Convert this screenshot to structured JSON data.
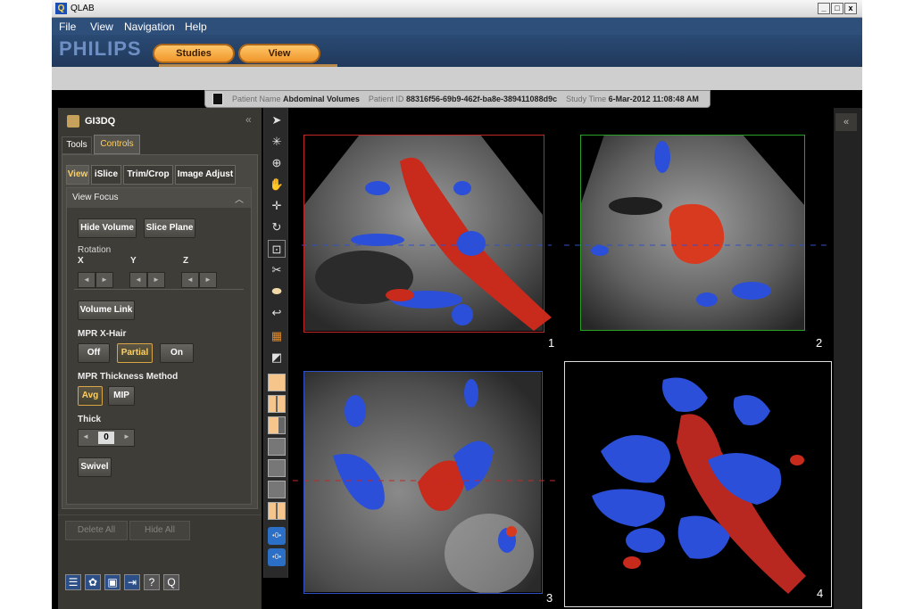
{
  "window": {
    "title": "QLAB",
    "app_icon": "Q",
    "min_label": "_",
    "max_label": "□",
    "close_label": "x"
  },
  "menu": [
    "File",
    "View",
    "Navigation",
    "Help"
  ],
  "brand": "PHILIPS",
  "tabs": [
    "Studies",
    "View"
  ],
  "patient": {
    "name_label": "Patient Name",
    "name": "Abdominal Volumes",
    "id_label": "Patient ID",
    "id": "88316f56-69b9-462f-ba8e-389411088d9c",
    "time_label": "Study Time",
    "time": "6-Mar-2012 11:08:48 AM"
  },
  "panel": {
    "title": "GI3DQ",
    "collapse": "«",
    "tabs": [
      "Tools",
      "Controls"
    ],
    "subtabs": [
      "View",
      "iSlice",
      "Trim/Crop",
      "Image Adjust"
    ],
    "section_title": "View Focus",
    "hide_volume": "Hide Volume",
    "slice_plane": "Slice Plane",
    "rotation_label": "Rotation",
    "axes": [
      "X",
      "Y",
      "Z"
    ],
    "left_arrow": "◄",
    "right_arrow": "►",
    "volume_link": "Volume Link",
    "xhair_label": "MPR X-Hair",
    "xhair_options": [
      "Off",
      "Partial",
      "On"
    ],
    "xhair_selected": "Partial",
    "thickness_label": "MPR Thickness Method",
    "thickness_options": [
      "Avg",
      "MIP"
    ],
    "thickness_selected": "Avg",
    "thick_label": "Thick",
    "thick_value": "0",
    "swivel": "Swivel",
    "delete_all": "Delete All",
    "hide_all": "Hide All"
  },
  "bottom_icons": [
    "list-icon",
    "settings-icon",
    "save-icon",
    "export-icon",
    "help-icon",
    "qlab-icon"
  ],
  "bottom_icon_glyphs": [
    "☰",
    "✿",
    "▣",
    "⇥",
    "?",
    "Q"
  ],
  "tools": [
    "pointer-icon",
    "brightness-icon",
    "zoom-icon",
    "pan-icon",
    "move-icon",
    "rotate-icon",
    "crop-select-icon",
    "scissors-icon",
    "eraser-icon",
    "undo-icon",
    "color-map-icon",
    "grayscale-icon"
  ],
  "tool_glyphs": [
    "➤",
    "✳",
    "⊕",
    "✋",
    "✛",
    "↻",
    "⊡",
    "✂",
    "⬬",
    "↩",
    "▦",
    "◩"
  ],
  "layouts": [
    "layout-1-icon",
    "layout-2x2-icon",
    "layout-1-2-icon",
    "layout-grid-a-icon",
    "layout-grid-b-icon",
    "layout-grid-c-icon",
    "layout-grid-d-icon"
  ],
  "link_buttons": [
    "link-a-icon",
    "link-b-icon"
  ],
  "link_glyphs": [
    "•0•",
    "•0•"
  ],
  "panes": [
    {
      "label": "1"
    },
    {
      "label": "2"
    },
    {
      "label": "3"
    },
    {
      "label": "4"
    }
  ],
  "right_collapse": "«",
  "colors": {
    "accent": "#f0962a",
    "menubar": "#2e4f7a",
    "frame_red": "#c02828",
    "frame_green": "#2aa02a",
    "frame_blue": "#3050c8"
  }
}
